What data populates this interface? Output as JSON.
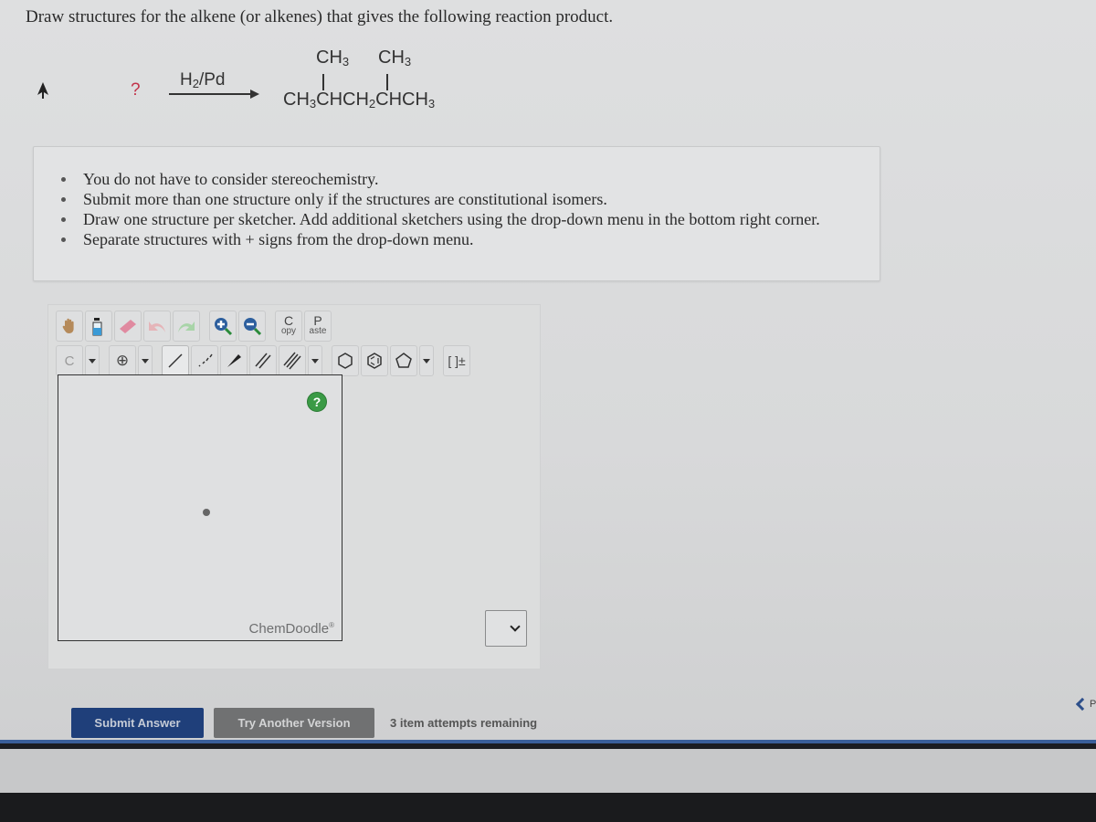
{
  "question": "Draw structures for the alkene (or alkenes) that gives the following reaction product.",
  "reaction": {
    "reactant": "?",
    "reagent_main": "H",
    "reagent_sub": "2",
    "reagent_rest": "/Pd",
    "substituent_1": "CH",
    "substituent_1_sub": "3",
    "substituent_2": "CH",
    "substituent_2_sub": "3",
    "product_parts": [
      "CH",
      "3",
      "CHCH",
      "2",
      "CHCH",
      "3"
    ]
  },
  "instructions": [
    "You do not have to consider stereochemistry.",
    "Submit more than one structure only if the structures are constitutional isomers.",
    "Draw one structure per sketcher. Add additional sketchers using the drop-down menu in the bottom right corner.",
    "Separate structures with + signs from the drop-down menu."
  ],
  "sketcher": {
    "toolbar_top": {
      "copy_big": "C",
      "copy_small": "opy",
      "paste_big": "P",
      "paste_small": "aste"
    },
    "toolbar_bottom": {
      "atom_label": "C",
      "charge_label": "⊕",
      "bracket_label": "[ ]±"
    },
    "help_label": "?",
    "brand": "ChemDoodle",
    "brand_mark": "®"
  },
  "actions": {
    "submit_label": "Submit Answer",
    "try_another_label": "Try Another Version",
    "attempts_text": "3 item attempts remaining",
    "prev_label": "P"
  },
  "colors": {
    "submit_bg": "#1f3f7a",
    "try_bg": "#707172",
    "help_green": "#3a9a45",
    "qmark_red": "#c2334a"
  }
}
